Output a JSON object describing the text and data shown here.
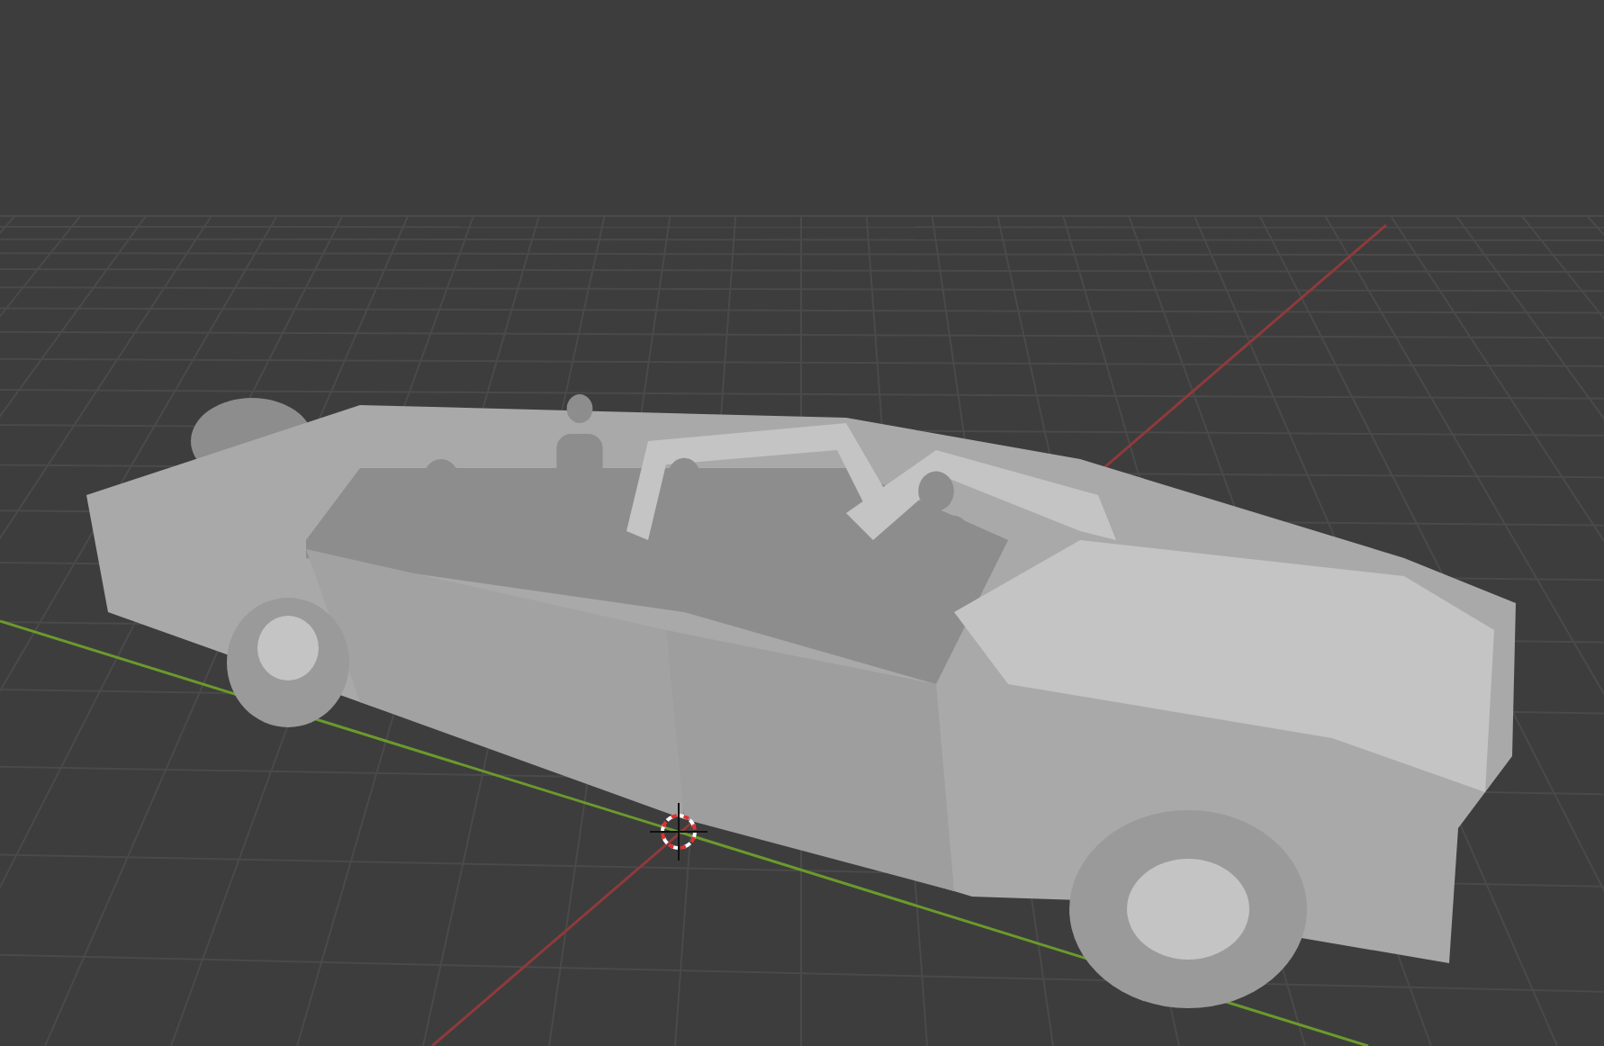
{
  "viewport": {
    "axes": [
      {
        "kind": "x",
        "color": "#8e3a3c"
      },
      {
        "kind": "y",
        "color": "#6b9a2c"
      }
    ],
    "cursor": true
  }
}
